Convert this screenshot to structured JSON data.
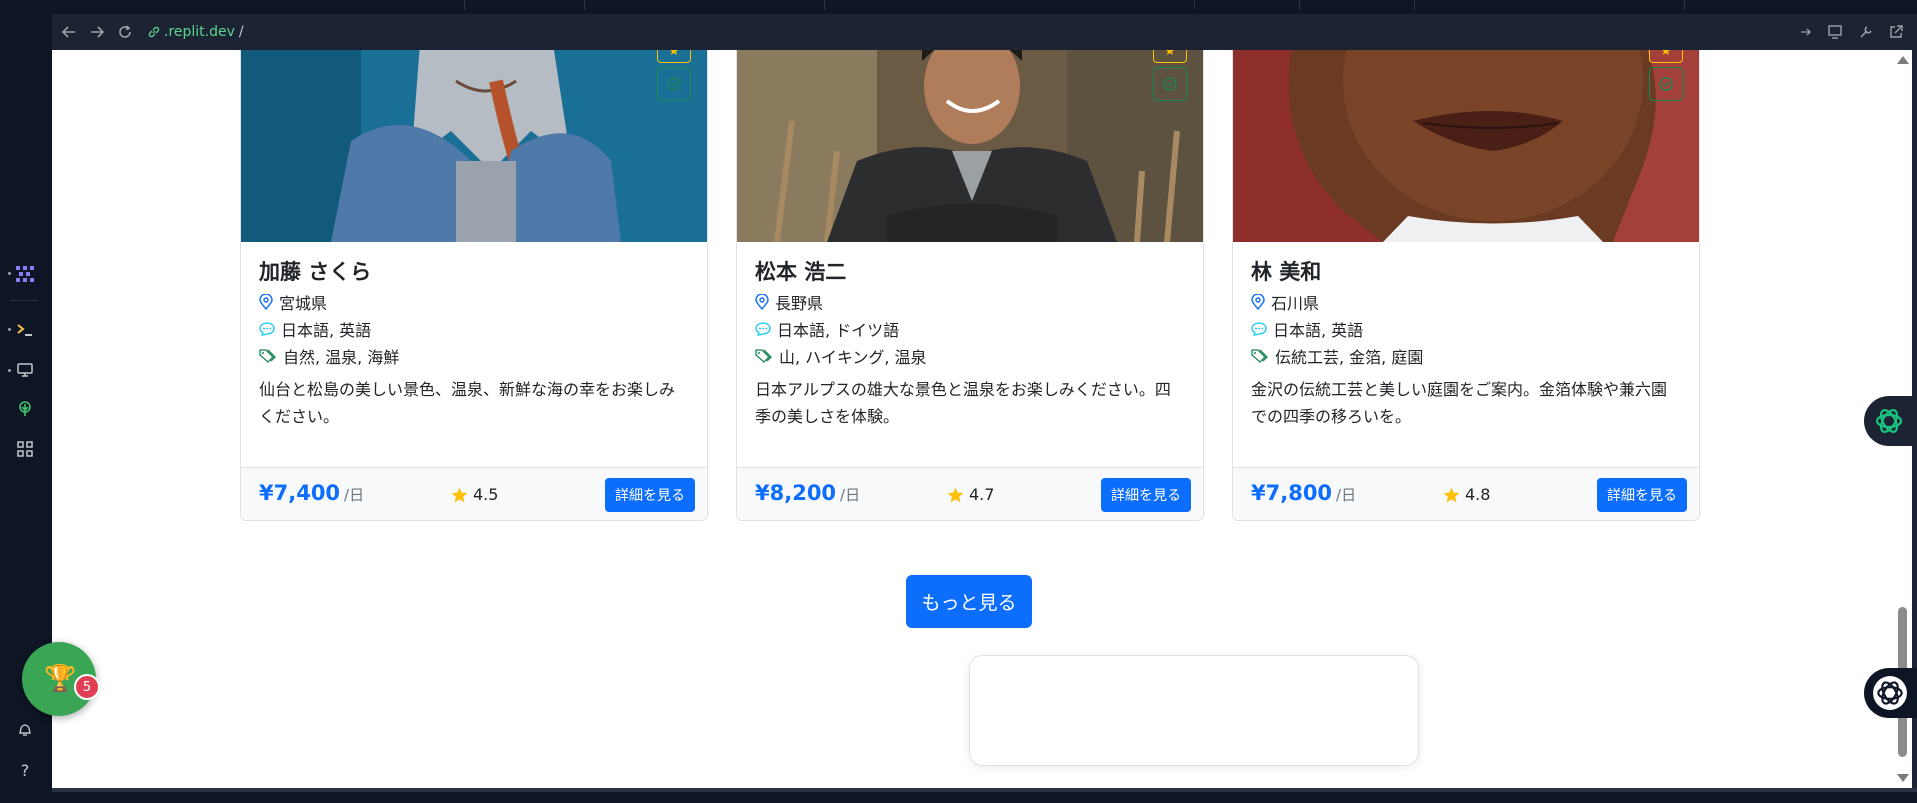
{
  "browser": {
    "url_host": ".replit.dev",
    "url_path": "/"
  },
  "guides": [
    {
      "name": "加藤 さくら",
      "location": "宮城県",
      "languages": "日本語, 英語",
      "tags": "自然, 温泉, 海鮮",
      "description": "仙台と松島の美しい景色、温泉、新鮮な海の幸をお楽しみください。",
      "price": "¥7,400",
      "price_unit": "/日",
      "rating": "4.5",
      "detail_label": "詳細を見る"
    },
    {
      "name": "松本 浩二",
      "location": "長野県",
      "languages": "日本語, ドイツ語",
      "tags": "山, ハイキング, 温泉",
      "description": "日本アルプスの雄大な景色と温泉をお楽しみください。四季の美しさを体験。",
      "price": "¥8,200",
      "price_unit": "/日",
      "rating": "4.7",
      "detail_label": "詳細を見る"
    },
    {
      "name": "林 美和",
      "location": "石川県",
      "languages": "日本語, 英語",
      "tags": "伝統工芸, 金箔, 庭園",
      "description": "金沢の伝統工芸と美しい庭園をご案内。金箔体験や兼六園での四季の移ろいを。",
      "price": "¥7,800",
      "price_unit": "/日",
      "rating": "4.8",
      "detail_label": "詳細を見る"
    }
  ],
  "more_button_label": "もっと見る",
  "trophy_badge_count": "5",
  "colors": {
    "primary": "#0d6efd",
    "star": "#ffc107",
    "success": "#198754"
  }
}
